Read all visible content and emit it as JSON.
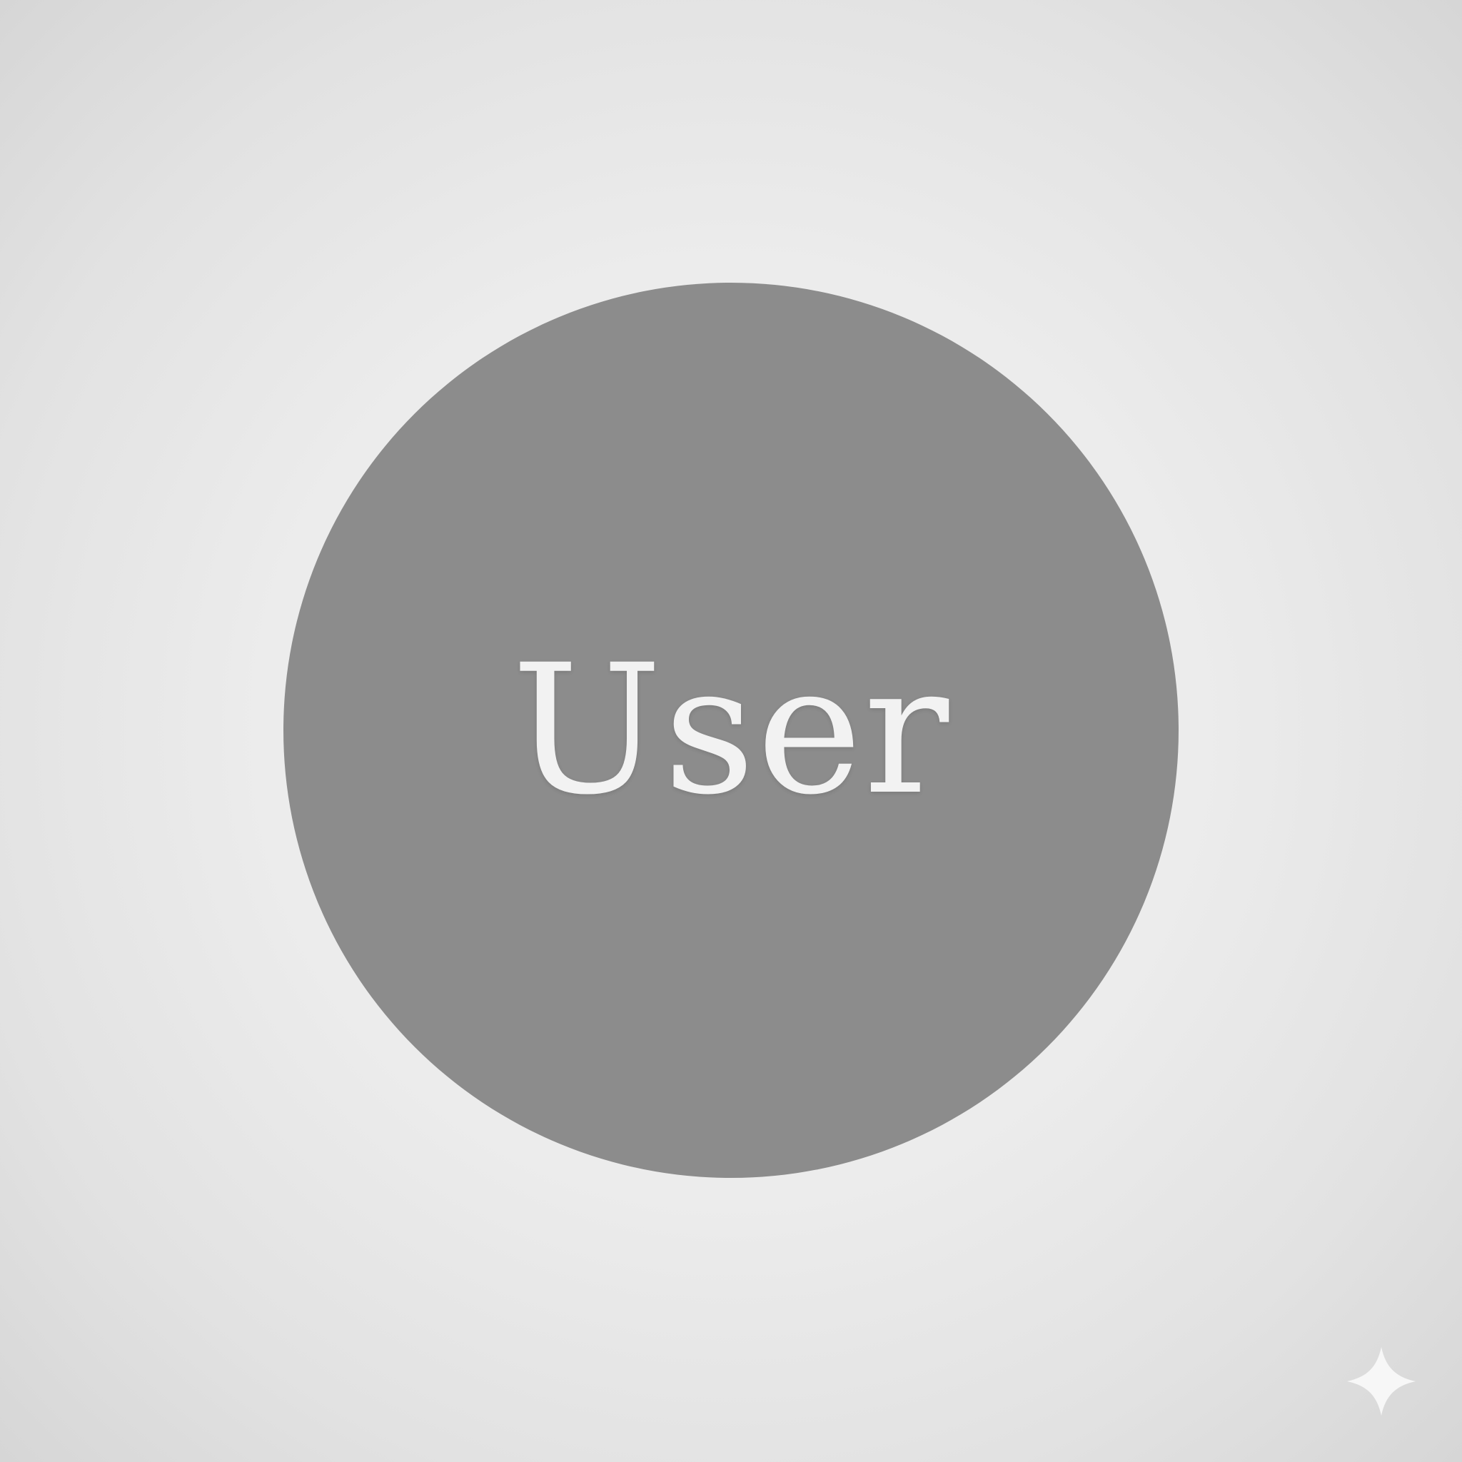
{
  "avatar": {
    "label": "User",
    "fill_color": "#8c8c8c",
    "text_color": "#f2f2f2"
  },
  "background": {
    "color": "#ececec"
  },
  "corner_mark": {
    "icon": "sparkle-icon",
    "color": "#f7f7f7"
  }
}
